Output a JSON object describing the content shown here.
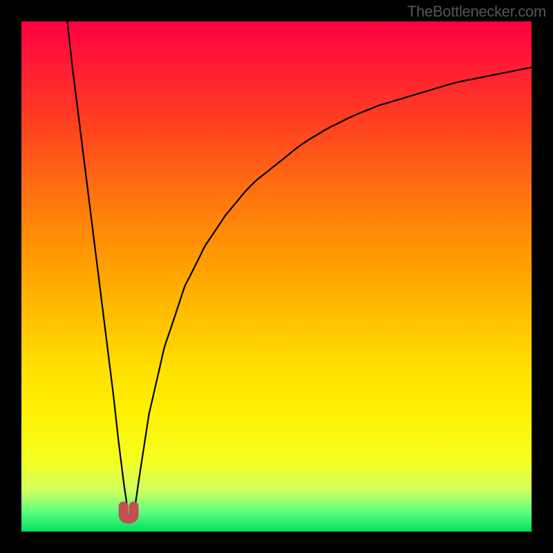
{
  "attribution": "TheBottlenecker.com",
  "chart_data": {
    "type": "line",
    "title": "",
    "xlabel": "",
    "ylabel": "",
    "xlim": [
      0,
      100
    ],
    "ylim": [
      0,
      100
    ],
    "grid": false,
    "series": [
      {
        "name": "bottleneck-curve",
        "x": [
          9,
          10,
          12,
          14,
          16,
          18,
          19,
          20,
          21,
          22,
          23,
          25,
          28,
          32,
          36,
          40,
          45,
          50,
          55,
          60,
          65,
          70,
          75,
          80,
          85,
          90,
          95,
          100
        ],
        "values": [
          100,
          91,
          75,
          59,
          43,
          27,
          18,
          10,
          3,
          3,
          10,
          23,
          36,
          48,
          56,
          62,
          68,
          72,
          76,
          79,
          81.5,
          83.5,
          85,
          86.5,
          88,
          89,
          90,
          91
        ]
      }
    ],
    "annotations": [
      {
        "name": "optimal-region-marker",
        "x_start": 20,
        "x_end": 22
      }
    ],
    "background": "vertical-gradient red→orange→yellow→green"
  }
}
